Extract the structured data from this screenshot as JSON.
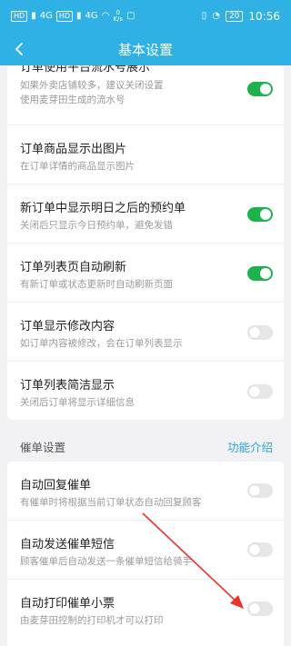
{
  "statusbar": {
    "hd_chip_1": "HD",
    "signal_1": "4G",
    "hd_chip_2": "HD",
    "signal_2": "4G",
    "speed_top": "0",
    "speed_bottom": "K/s",
    "battery": "20",
    "time": "10:56"
  },
  "header": {
    "title": "基本设置"
  },
  "settings": [
    {
      "title": "订单使用平台流水号展示",
      "desc": "如果外卖店铺较多，建议关闭设置",
      "desc2": "使用麦芽田生成的流水号",
      "on": true
    },
    {
      "title": "订单商品显示出图片",
      "desc": "在订单详情的商品显示图片",
      "on": true
    },
    {
      "title": "新订单中显示明日之后的预约单",
      "desc": "关闭后只显示今日预约单，避免发错",
      "on": true
    },
    {
      "title": "订单列表页自动刷新",
      "desc": "有新订单或状态更新时自动刷新页面",
      "on": true
    },
    {
      "title": "订单显示修改内容",
      "desc": "如订单内容被修改，会在订单列表显示",
      "on": false
    },
    {
      "title": "订单列表简洁显示",
      "desc": "关闭后订单将显示详细信息",
      "on": false
    }
  ],
  "reminder_section": {
    "label": "催单设置",
    "link": "功能介绍"
  },
  "reminder_settings": [
    {
      "title": "自动回复催单",
      "desc": "有催单时将根据当前订单状态自动回复顾客",
      "on": false
    },
    {
      "title": "自动发送催单短信",
      "desc": "顾客催单后自动发送一条催单短信给骑手",
      "on": false
    },
    {
      "title": "自动打印催单小票",
      "desc": "由麦芽田控制的打印机才可以打印",
      "on": false
    }
  ],
  "colors": {
    "header": "#2fb1e6",
    "toggle_on": "#1eb24f",
    "toggle_off": "#e6e6e6",
    "link": "#2aa3d8",
    "annotation_arrow": "#e8322b"
  }
}
